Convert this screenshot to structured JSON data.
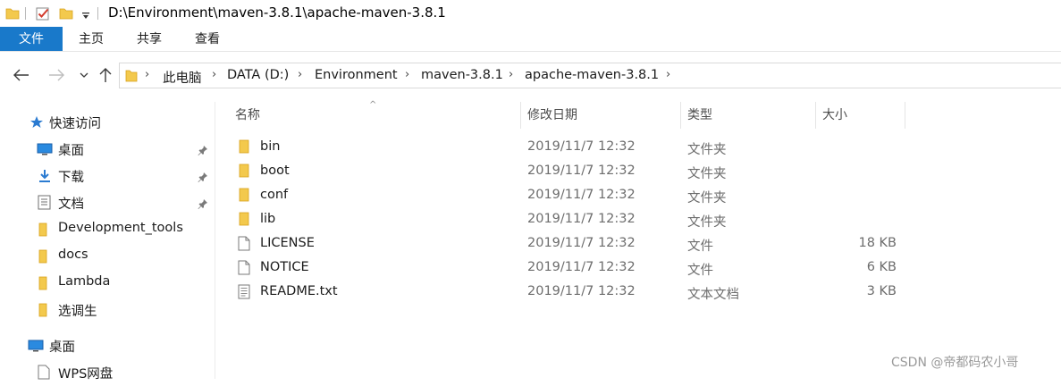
{
  "window": {
    "title_path": "D:\\Environment\\maven-3.8.1\\apache-maven-3.8.1",
    "quick_access_icons": [
      "folder-icon",
      "checkbox-properties-icon",
      "new-folder-icon",
      "dropdown-arrow-icon"
    ]
  },
  "ribbon": {
    "tabs": [
      {
        "label": "文件",
        "active": true
      },
      {
        "label": "主页"
      },
      {
        "label": "共享"
      },
      {
        "label": "查看"
      }
    ],
    "accent": "#1979ca"
  },
  "nav": {
    "back_icon": "arrow-left-icon",
    "forward_icon": "arrow-right-icon",
    "recent_icon": "chevron-down-icon",
    "up_icon": "arrow-up-icon",
    "breadcrumb": [
      "此电脑",
      "DATA (D:)",
      "Environment",
      "maven-3.8.1",
      "apache-maven-3.8.1"
    ]
  },
  "sidebar": {
    "quick_access_label": "快速访问",
    "items": [
      {
        "label": "桌面",
        "icon": "desktop-icon",
        "pinned": true
      },
      {
        "label": "下载",
        "icon": "download-icon",
        "pinned": true
      },
      {
        "label": "文档",
        "icon": "document-icon",
        "pinned": true
      },
      {
        "label": "Development_tools",
        "icon": "folder-icon"
      },
      {
        "label": "docs",
        "icon": "folder-icon"
      },
      {
        "label": "Lambda",
        "icon": "folder-icon"
      },
      {
        "label": "选调生",
        "icon": "folder-icon"
      }
    ],
    "desktop_label": "桌面",
    "wps_label": "WPS网盘"
  },
  "list": {
    "columns": {
      "name": "名称",
      "date": "修改日期",
      "type": "类型",
      "size": "大小"
    },
    "rows": [
      {
        "name": "bin",
        "date": "2019/11/7 12:32",
        "type": "文件夹",
        "size": "",
        "kind": "folder"
      },
      {
        "name": "boot",
        "date": "2019/11/7 12:32",
        "type": "文件夹",
        "size": "",
        "kind": "folder"
      },
      {
        "name": "conf",
        "date": "2019/11/7 12:32",
        "type": "文件夹",
        "size": "",
        "kind": "folder"
      },
      {
        "name": "lib",
        "date": "2019/11/7 12:32",
        "type": "文件夹",
        "size": "",
        "kind": "folder"
      },
      {
        "name": "LICENSE",
        "date": "2019/11/7 12:32",
        "type": "文件",
        "size": "18 KB",
        "kind": "file"
      },
      {
        "name": "NOTICE",
        "date": "2019/11/7 12:32",
        "type": "文件",
        "size": "6 KB",
        "kind": "file"
      },
      {
        "name": "README.txt",
        "date": "2019/11/7 12:32",
        "type": "文本文档",
        "size": "3 KB",
        "kind": "textfile"
      }
    ]
  },
  "watermark": "CSDN @帝都码农小哥"
}
